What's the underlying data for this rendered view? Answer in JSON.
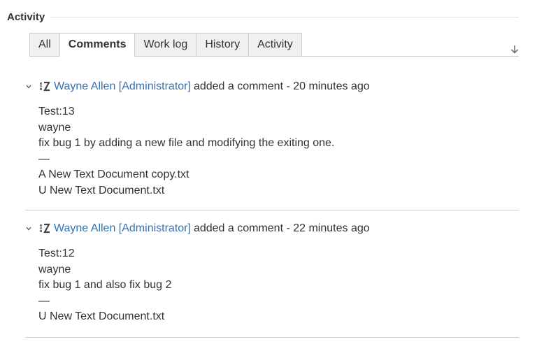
{
  "section": {
    "title": "Activity"
  },
  "tabs": [
    {
      "label": "All",
      "active": false
    },
    {
      "label": "Comments",
      "active": true
    },
    {
      "label": "Work log",
      "active": false
    },
    {
      "label": "History",
      "active": false
    },
    {
      "label": "Activity",
      "active": false
    }
  ],
  "sort_icon": "arrow-down-icon",
  "comments": [
    {
      "author": "Wayne Allen [Administrator]",
      "action": "added a comment - 20 minutes ago",
      "lines": [
        "Test:13",
        "wayne",
        "fix bug 1 by adding a new file and modifying the exiting one.",
        "—",
        "A New Text Document copy.txt",
        "U New Text Document.txt"
      ]
    },
    {
      "author": "Wayne Allen [Administrator]",
      "action": "added a comment - 22 minutes ago",
      "lines": [
        "Test:12",
        "wayne",
        "fix bug 1 and also fix bug 2",
        "—",
        "U New Text Document.txt"
      ]
    }
  ],
  "colors": {
    "link": "#3572b0",
    "text": "#333333",
    "tab_inactive_bg": "#f0f0f0",
    "border": "#cccccc"
  }
}
